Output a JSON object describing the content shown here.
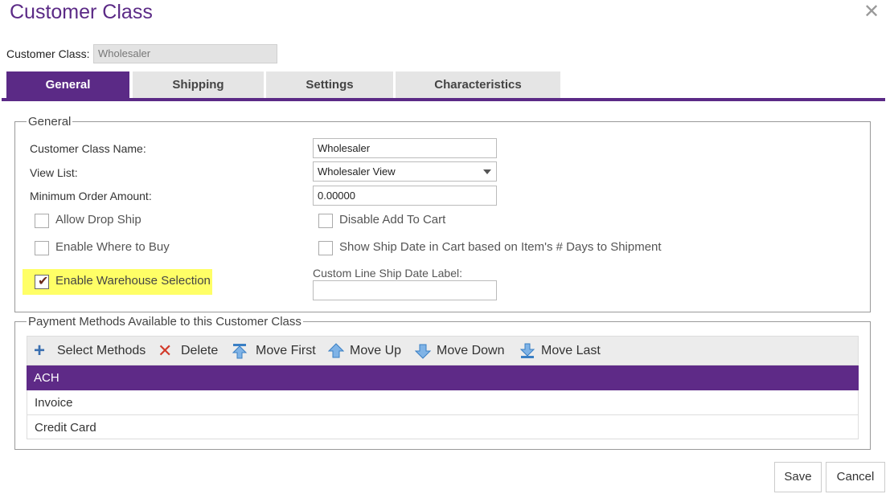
{
  "window": {
    "title": "Customer Class",
    "close_icon": "close-icon"
  },
  "customer_class": {
    "label": "Customer Class:",
    "value": "Wholesaler"
  },
  "tabs": [
    {
      "label": "General",
      "active": true
    },
    {
      "label": "Shipping",
      "active": false
    },
    {
      "label": "Settings",
      "active": false
    },
    {
      "label": "Characteristics",
      "active": false
    }
  ],
  "general": {
    "legend": "General",
    "class_name_label": "Customer Class Name:",
    "class_name_value": "Wholesaler",
    "view_list_label": "View List:",
    "view_list_value": "Wholesaler View",
    "min_order_label": "Minimum Order Amount:",
    "min_order_value": "0.00000",
    "allow_drop_ship": {
      "label": "Allow Drop Ship",
      "checked": false
    },
    "enable_where_to_buy": {
      "label": "Enable Where to Buy",
      "checked": false
    },
    "enable_warehouse_selection": {
      "label": "Enable Warehouse Selection",
      "checked": true
    },
    "disable_add_to_cart": {
      "label": "Disable Add To Cart",
      "checked": false
    },
    "show_ship_date": {
      "label": "Show Ship Date in Cart based on Item's # Days to Shipment",
      "checked": false
    },
    "custom_ship_date_label": "Custom Line Ship Date Label:",
    "custom_ship_date_value": ""
  },
  "payment": {
    "legend": "Payment Methods Available to this Customer Class",
    "toolbar": {
      "select_methods": "Select Methods",
      "delete": "Delete",
      "move_first": "Move First",
      "move_up": "Move Up",
      "move_down": "Move Down",
      "move_last": "Move Last"
    },
    "rows": [
      "ACH",
      "Invoice",
      "Credit Card"
    ],
    "selected_index": 0
  },
  "footer": {
    "save": "Save",
    "cancel": "Cancel"
  },
  "colors": {
    "accent": "#5b2a86",
    "highlight": "#ffff66"
  }
}
